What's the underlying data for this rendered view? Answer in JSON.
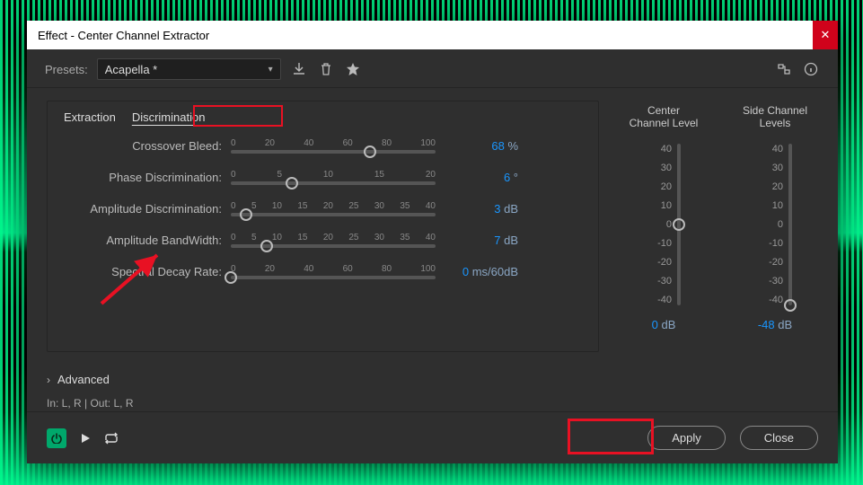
{
  "window": {
    "title": "Effect - Center Channel Extractor"
  },
  "preset_row": {
    "label": "Presets:",
    "selected": "Acapella *"
  },
  "tabs": {
    "extraction": "Extraction",
    "discrimination": "Discrimination",
    "active": "discrimination"
  },
  "sliders": {
    "crossover": {
      "label": "Crossover Bleed:",
      "ticks": [
        "0",
        "20",
        "40",
        "60",
        "80",
        "100"
      ],
      "value": "68",
      "unit": "%",
      "pos_pct": 68
    },
    "phase": {
      "label": "Phase Discrimination:",
      "ticks": [
        "0",
        "5",
        "10",
        "15",
        "20"
      ],
      "value": "6",
      "unit": "°",
      "pos_pct": 30
    },
    "amplitude": {
      "label": "Amplitude Discrimination:",
      "ticks": [
        "0",
        "5",
        "10",
        "15",
        "20",
        "25",
        "30",
        "35",
        "40"
      ],
      "value": "3",
      "unit": "dB",
      "pos_pct": 7.5
    },
    "bandwidth": {
      "label": "Amplitude BandWidth:",
      "ticks": [
        "0",
        "5",
        "10",
        "15",
        "20",
        "25",
        "30",
        "35",
        "40"
      ],
      "value": "7",
      "unit": "dB",
      "pos_pct": 17.5
    },
    "decay": {
      "label": "Spectral Decay Rate:",
      "ticks": [
        "0",
        "20",
        "40",
        "60",
        "80",
        "100"
      ],
      "value": "0",
      "unit": "ms/60dB",
      "pos_pct": 0
    }
  },
  "levels": {
    "center": {
      "title": "Center\nChannel Level",
      "ticks": [
        "40",
        "30",
        "20",
        "10",
        "0",
        "-10",
        "-20",
        "-30",
        "-40"
      ],
      "value": "0",
      "unit": "dB",
      "pos_pct": 50
    },
    "side": {
      "title": "Side Channel\nLevels",
      "ticks": [
        "40",
        "30",
        "20",
        "10",
        "0",
        "-10",
        "-20",
        "-30",
        "-40"
      ],
      "value": "-48",
      "unit": "dB",
      "pos_pct": 100
    }
  },
  "advanced": {
    "label": "Advanced"
  },
  "io": {
    "text": "In: L, R | Out: L, R"
  },
  "footer": {
    "apply": "Apply",
    "close": "Close"
  }
}
